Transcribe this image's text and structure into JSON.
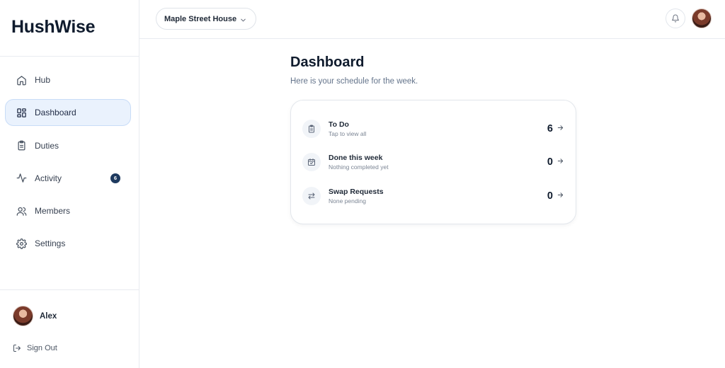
{
  "app": {
    "brand": "HushWise"
  },
  "sidebar": {
    "items": [
      {
        "label": "Hub",
        "icon": "home-icon"
      },
      {
        "label": "Dashboard",
        "icon": "grid-icon",
        "active": true
      },
      {
        "label": "Duties",
        "icon": "clipboard-icon"
      },
      {
        "label": "Activity",
        "icon": "activity-icon",
        "badge": "6"
      },
      {
        "label": "Members",
        "icon": "users-icon"
      },
      {
        "label": "Settings",
        "icon": "gear-icon"
      }
    ],
    "user": {
      "name": "Alex"
    },
    "signout_label": "Sign Out"
  },
  "topbar": {
    "house": "Maple Street House"
  },
  "main": {
    "title": "Dashboard",
    "subtitle": "Here is your schedule for the week.",
    "rows": [
      {
        "title": "To Do",
        "sub": "Tap to view all",
        "count": "6",
        "icon": "clipboard-icon"
      },
      {
        "title": "Done this week",
        "sub": "Nothing completed yet",
        "count": "0",
        "icon": "calendar-check-icon"
      },
      {
        "title": "Swap Requests",
        "sub": "None pending",
        "count": "0",
        "icon": "swap-icon"
      }
    ]
  },
  "colors": {
    "accent_bg": "#eaf2fd",
    "accent_border": "#c8dcf7",
    "badge": "#1e3a5f",
    "text_dark": "#0f1b2d",
    "muted": "#64748b"
  }
}
